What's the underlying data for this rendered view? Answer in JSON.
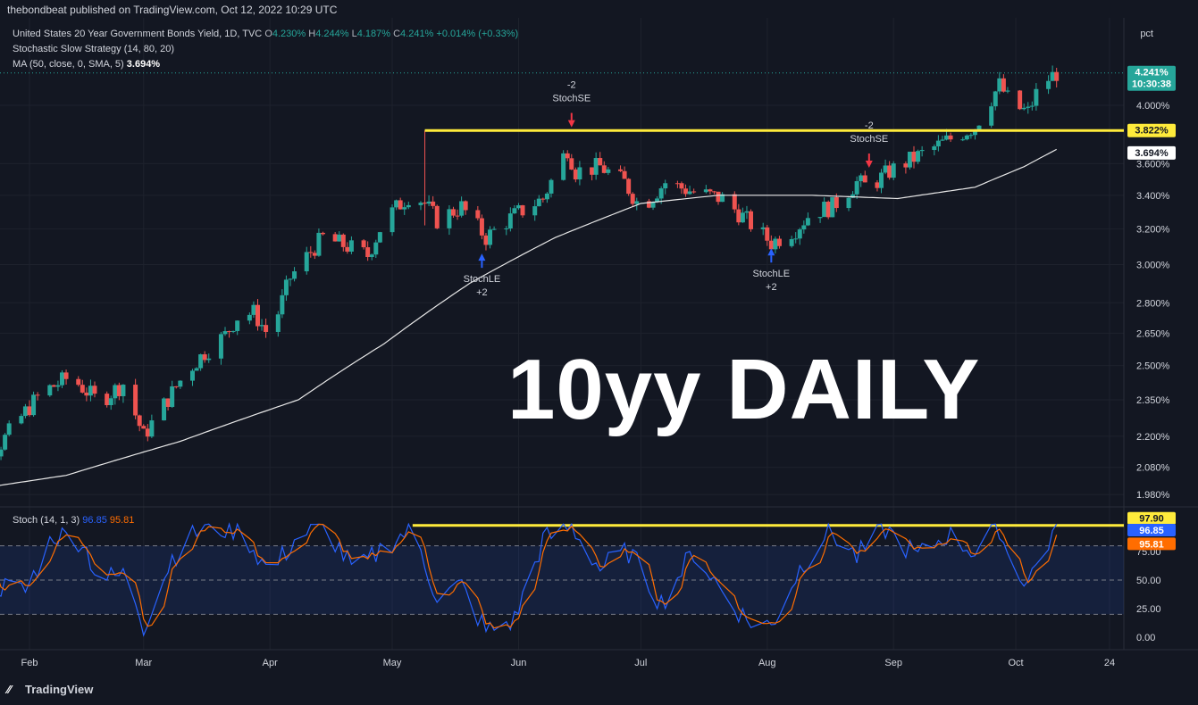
{
  "header": {
    "published": "thebondbeat published on TradingView.com, Oct 12, 2022 10:29 UTC"
  },
  "legend": {
    "symbol": "United States 20 Year Government Bonds Yield, 1D, TVC",
    "o_label": "O",
    "o_value": "4.230%",
    "h_label": "H",
    "h_value": "4.244%",
    "l_label": "L",
    "l_value": "4.187%",
    "c_label": "C",
    "c_value": "4.241%",
    "change": "+0.014% (+0.33%)",
    "strategy": "Stochastic Slow Strategy (14, 80, 20)",
    "ma_label": "MA (50, close, 0, SMA, 5)",
    "ma_value": "3.694%"
  },
  "price_unit": "pct",
  "watermark": "10yy DAILY",
  "stoch_legend": {
    "label": "Stoch (14, 1, 3)",
    "k_value": "96.85",
    "d_value": "95.81"
  },
  "branding": "TradingView",
  "colors": {
    "background": "#131722",
    "up": "#26a69a",
    "down": "#ef5350",
    "ma": "#e8e8e8",
    "resistance": "#ffeb3b",
    "stoch_k": "#2962ff",
    "stoch_d": "#ff6d00",
    "last_price_tag": "#26a69a"
  },
  "chart_data": {
    "type": "candlestick",
    "price_axis": {
      "ticks": [
        "4.000%",
        "3.600%",
        "3.400%",
        "3.200%",
        "3.000%",
        "2.800%",
        "2.650%",
        "2.500%",
        "2.350%",
        "2.200%",
        "2.080%",
        "1.980%"
      ],
      "scale": "log"
    },
    "time_axis": [
      "Feb",
      "Mar",
      "Apr",
      "May",
      "Jun",
      "Jul",
      "Aug",
      "Sep",
      "Oct",
      "24"
    ],
    "price_tags": {
      "last_price": "4.241%",
      "countdown": "10:30:38",
      "resistance": "3.822%",
      "ma": "3.694%"
    },
    "resistance_level": 3.822,
    "signals": [
      {
        "label": "StochSE",
        "qty": "-2",
        "direction": "short",
        "date": "Jun 14",
        "price": 3.82
      },
      {
        "label": "StochLE",
        "qty": "+2",
        "direction": "long",
        "date": "May 23",
        "price": 3.12
      },
      {
        "label": "StochSE",
        "qty": "-2",
        "direction": "short",
        "date": "Aug 26",
        "price": 3.55
      },
      {
        "label": "StochLE",
        "qty": "+2",
        "direction": "long",
        "date": "Aug 2",
        "price": 3.15
      }
    ],
    "close_series": {
      "name": "",
      "anchors": [
        [
          "Jan 12",
          2.18
        ],
        [
          "Jan 18",
          2.3
        ],
        [
          "Jan 24",
          2.15
        ],
        [
          "Jan 31",
          2.3
        ],
        [
          "Feb 4",
          2.38
        ],
        [
          "Feb 11",
          2.45
        ],
        [
          "Feb 18",
          2.34
        ],
        [
          "Feb 24",
          2.42
        ],
        [
          "Mar 1",
          2.2
        ],
        [
          "Mar 8",
          2.38
        ],
        [
          "Mar 11",
          2.46
        ],
        [
          "Mar 16",
          2.56
        ],
        [
          "Mar 21",
          2.64
        ],
        [
          "Mar 24",
          2.73
        ],
        [
          "Mar 28",
          2.75
        ],
        [
          "Apr 1",
          2.63
        ],
        [
          "Apr 6",
          2.93
        ],
        [
          "Apr 11",
          3.07
        ],
        [
          "Apr 14",
          3.15
        ],
        [
          "Apr 20",
          3.1
        ],
        [
          "Apr 25",
          3.05
        ],
        [
          "Apr 29",
          3.25
        ],
        [
          "May 6",
          3.42
        ],
        [
          "May 9",
          3.35
        ],
        [
          "May 12",
          3.25
        ],
        [
          "May 18",
          3.33
        ],
        [
          "May 24",
          3.15
        ],
        [
          "May 31",
          3.28
        ],
        [
          "Jun 7",
          3.38
        ],
        [
          "Jun 13",
          3.7
        ],
        [
          "Jun 15",
          3.55
        ],
        [
          "Jun 21",
          3.58
        ],
        [
          "Jun 27",
          3.48
        ],
        [
          "Jul 1",
          3.32
        ],
        [
          "Jul 7",
          3.48
        ],
        [
          "Jul 14",
          3.42
        ],
        [
          "Jul 21",
          3.38
        ],
        [
          "Jul 27",
          3.25
        ],
        [
          "Aug 2",
          3.12
        ],
        [
          "Aug 8",
          3.2
        ],
        [
          "Aug 12",
          3.3
        ],
        [
          "Aug 17",
          3.33
        ],
        [
          "Aug 23",
          3.48
        ],
        [
          "Aug 26",
          3.45
        ],
        [
          "Aug 31",
          3.55
        ],
        [
          "Sep 7",
          3.65
        ],
        [
          "Sep 12",
          3.72
        ],
        [
          "Sep 16",
          3.78
        ],
        [
          "Sep 21",
          3.85
        ],
        [
          "Sep 27",
          4.15
        ],
        [
          "Sep 30",
          4.0
        ],
        [
          "Oct 4",
          3.95
        ],
        [
          "Oct 7",
          4.15
        ],
        [
          "Oct 11",
          4.24
        ]
      ]
    },
    "ma_series": {
      "name": "MA (50, close, 0, SMA, 5)",
      "anchors": [
        [
          "Jan 10",
          1.98
        ],
        [
          "Feb 10",
          2.05
        ],
        [
          "Mar 10",
          2.18
        ],
        [
          "Apr 8",
          2.35
        ],
        [
          "Apr 29",
          2.6
        ],
        [
          "May 20",
          2.9
        ],
        [
          "Jun 10",
          3.15
        ],
        [
          "Jul 1",
          3.35
        ],
        [
          "Jul 20",
          3.4
        ],
        [
          "Aug 12",
          3.4
        ],
        [
          "Sep 2",
          3.38
        ],
        [
          "Sep 21",
          3.45
        ],
        [
          "Oct 3",
          3.58
        ],
        [
          "Oct 11",
          3.694
        ]
      ]
    },
    "stochastic": {
      "name": "Stoch (14, 1, 3)",
      "axis_ticks": [
        "97.90",
        "75.00",
        "50.00",
        "25.00",
        "0.00"
      ],
      "levels": [
        80,
        50,
        20
      ],
      "last_k": 96.85,
      "last_d": 95.81,
      "overbought_line": 97.9,
      "k_anchors": [
        [
          "Jan 10",
          85
        ],
        [
          "Jan 17",
          95
        ],
        [
          "Jan 24",
          45
        ],
        [
          "Jan 31",
          40
        ],
        [
          "Feb 7",
          90
        ],
        [
          "Feb 14",
          85
        ],
        [
          "Feb 18",
          50
        ],
        [
          "Feb 25",
          55
        ],
        [
          "Mar 1",
          10
        ],
        [
          "Mar 8",
          70
        ],
        [
          "Mar 15",
          95
        ],
        [
          "Mar 25",
          95
        ],
        [
          "Apr 1",
          55
        ],
        [
          "Apr 8",
          90
        ],
        [
          "Apr 15",
          95
        ],
        [
          "Apr 22",
          55
        ],
        [
          "Apr 29",
          80
        ],
        [
          "May 6",
          95
        ],
        [
          "May 12",
          35
        ],
        [
          "May 18",
          45
        ],
        [
          "May 24",
          5
        ],
        [
          "May 31",
          15
        ],
        [
          "Jun 7",
          85
        ],
        [
          "Jun 14",
          97
        ],
        [
          "Jun 21",
          60
        ],
        [
          "Jun 28",
          75
        ],
        [
          "Jul 6",
          30
        ],
        [
          "Jul 14",
          75
        ],
        [
          "Jul 21",
          40
        ],
        [
          "Jul 27",
          15
        ],
        [
          "Aug 2",
          10
        ],
        [
          "Aug 9",
          60
        ],
        [
          "Aug 16",
          95
        ],
        [
          "Aug 23",
          70
        ],
        [
          "Aug 30",
          95
        ],
        [
          "Sep 7",
          70
        ],
        [
          "Sep 14",
          90
        ],
        [
          "Sep 21",
          75
        ],
        [
          "Sep 27",
          97
        ],
        [
          "Sep 30",
          60
        ],
        [
          "Oct 4",
          50
        ],
        [
          "Oct 11",
          96.85
        ]
      ]
    }
  }
}
